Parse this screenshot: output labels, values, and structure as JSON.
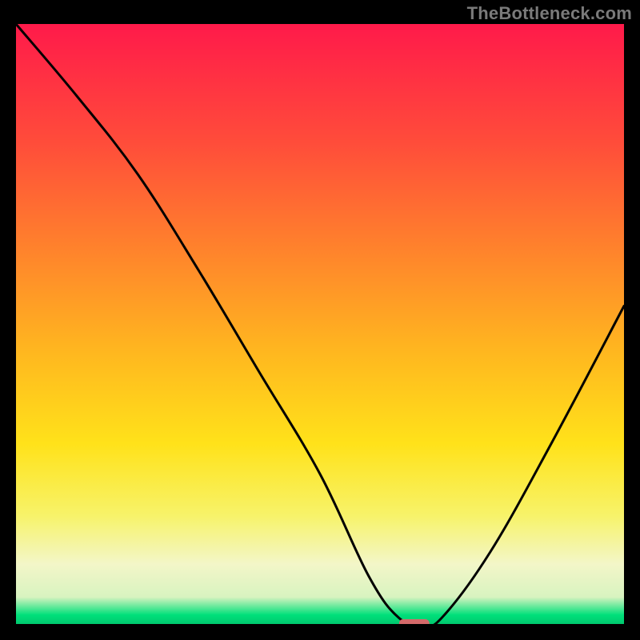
{
  "watermark": "TheBottleneck.com",
  "chart_data": {
    "type": "line",
    "title": "",
    "xlabel": "",
    "ylabel": "",
    "xlim": [
      0,
      100
    ],
    "ylim": [
      0,
      100
    ],
    "x": [
      0,
      10,
      20,
      30,
      40,
      50,
      58,
      63,
      67,
      70,
      78,
      88,
      100
    ],
    "values": [
      100,
      88,
      75,
      59,
      42,
      25,
      8,
      1,
      0,
      1,
      12,
      30,
      53
    ],
    "minimum_marker": {
      "x_start": 63,
      "x_end": 68,
      "y": 0
    },
    "gradient_stops": [
      {
        "offset": 0.0,
        "color": "#ff1a4a"
      },
      {
        "offset": 0.2,
        "color": "#ff4d3a"
      },
      {
        "offset": 0.4,
        "color": "#ff8a2a"
      },
      {
        "offset": 0.55,
        "color": "#ffb81f"
      },
      {
        "offset": 0.7,
        "color": "#ffe21a"
      },
      {
        "offset": 0.82,
        "color": "#f7f36a"
      },
      {
        "offset": 0.9,
        "color": "#f3f6c8"
      },
      {
        "offset": 0.955,
        "color": "#d8f3c0"
      },
      {
        "offset": 0.985,
        "color": "#00e07a"
      },
      {
        "offset": 1.0,
        "color": "#00c86e"
      }
    ]
  }
}
